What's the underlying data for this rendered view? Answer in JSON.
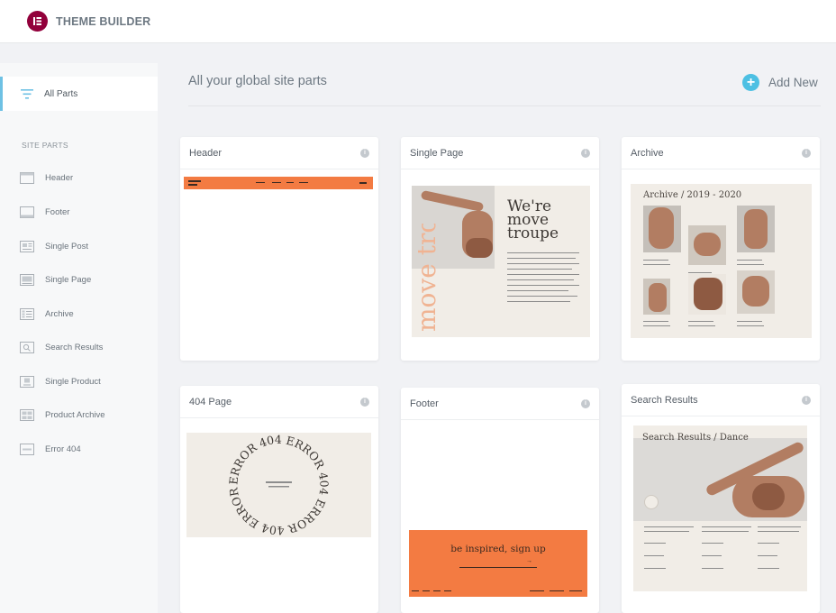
{
  "app": {
    "title": "THEME BUILDER",
    "logo_letter": "E",
    "brand_color": "#92003b",
    "accent_color": "#6ec1e4"
  },
  "sidebar": {
    "all_parts_label": "All Parts",
    "section_heading": "SITE PARTS",
    "items": [
      {
        "label": "Header",
        "icon": "header-layout-icon"
      },
      {
        "label": "Footer",
        "icon": "footer-layout-icon"
      },
      {
        "label": "Single Post",
        "icon": "single-post-icon"
      },
      {
        "label": "Single Page",
        "icon": "single-page-icon"
      },
      {
        "label": "Archive",
        "icon": "archive-icon"
      },
      {
        "label": "Search Results",
        "icon": "search-results-icon"
      },
      {
        "label": "Single Product",
        "icon": "single-product-icon"
      },
      {
        "label": "Product Archive",
        "icon": "product-archive-icon"
      },
      {
        "label": "Error 404",
        "icon": "error-404-icon"
      }
    ]
  },
  "main": {
    "title": "All your global site parts",
    "add_new_label": "Add New",
    "cards": [
      {
        "title": "Header"
      },
      {
        "title": "Single Page",
        "preview_heading": "We're move troupe",
        "preview_side": "move troupe"
      },
      {
        "title": "Archive",
        "preview_heading": "Archive / 2019 - 2020"
      },
      {
        "title": "404 Page",
        "preview_ring": "ERROR 404 ERROR 404 ERROR 404 ERROR 404 "
      },
      {
        "title": "Footer",
        "preview_cta": "be inspired, sign up"
      },
      {
        "title": "Search Results",
        "preview_heading": "Search Results / Dance"
      }
    ]
  }
}
